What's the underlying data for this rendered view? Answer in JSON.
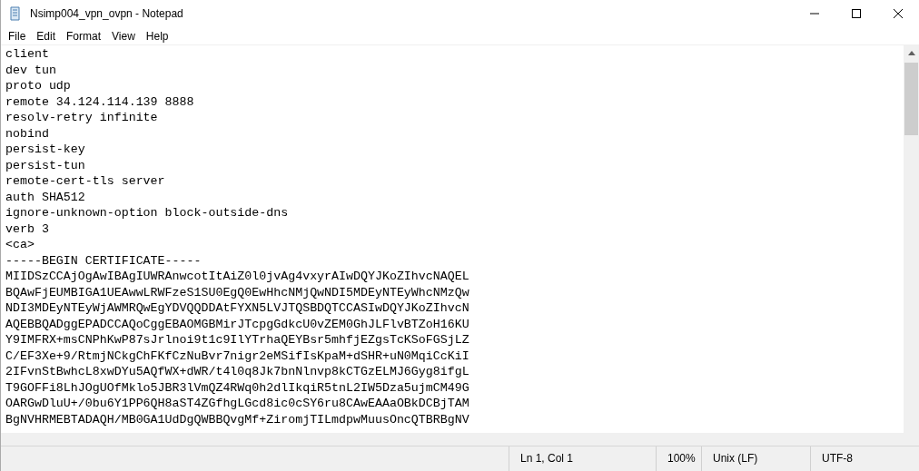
{
  "window": {
    "title": "Nsimp004_vpn_ovpn - Notepad"
  },
  "menu": [
    "File",
    "Edit",
    "Format",
    "View",
    "Help"
  ],
  "lines": [
    "client",
    "dev tun",
    "proto udp",
    "remote 34.124.114.139 8888",
    "resolv-retry infinite",
    "nobind",
    "persist-key",
    "persist-tun",
    "remote-cert-tls server",
    "auth SHA512",
    "ignore-unknown-option block-outside-dns",
    "verb 3",
    "<ca>",
    "-----BEGIN CERTIFICATE-----",
    "MIIDSzCCAjOgAwIBAgIUWRAnwcotItAiZ0l0jvAg4vxyrAIwDQYJKoZIhvcNAQEL",
    "BQAwFjEUMBIGA1UEAwwLRWFzeS1SU0EgQ0EwHhcNMjQwNDI5MDEyNTEyWhcNMzQw",
    "NDI3MDEyNTEyWjAWMRQwEgYDVQQDDAtFYXN5LVJTQSBDQTCCASIwDQYJKoZIhvcN",
    "AQEBBQADggEPADCCAQoCggEBAOMGBMirJTcpgGdkcU0vZEM0GhJLFlvBTZoH16KU",
    "Y9IMFRX+msCNPhKwP87sJrlnoi9t1c9IlYTrhaQEYBsr5mhfjEZgsTcKSoFGSjLZ",
    "C/EF3Xe+9/RtmjNCkgChFKfCzNuBvr7nigr2eMSifIsKpaM+dSHR+uN0MqiCcKiI",
    "2IFvnStBwhcL8xwDYu5AQfWX+dWR/t4l0q8Jk7bnNlnvp8kCTGzELMJ6Gyg8ifgL",
    "T9GOFFi8LhJOgUOfMklo5JBR3lVmQZ4RWq0h2dlIkqiR5tnL2IW5Dza5ujmCM49G",
    "OARGwDluU+/0bu6Y1PP6QH8aST4ZGfhgLGcd8ic0cSY6ru8CAwEAAaOBkDCBjTAM",
    "BgNVHRMEBTADAQH/MB0GA1UdDgQWBBQvgMf+ZiromjTILmdpwMuusOncQTBRBgNV"
  ],
  "status": {
    "position": "Ln 1, Col 1",
    "zoom": "100%",
    "line_endings": "Unix (LF)",
    "encoding": "UTF-8"
  }
}
